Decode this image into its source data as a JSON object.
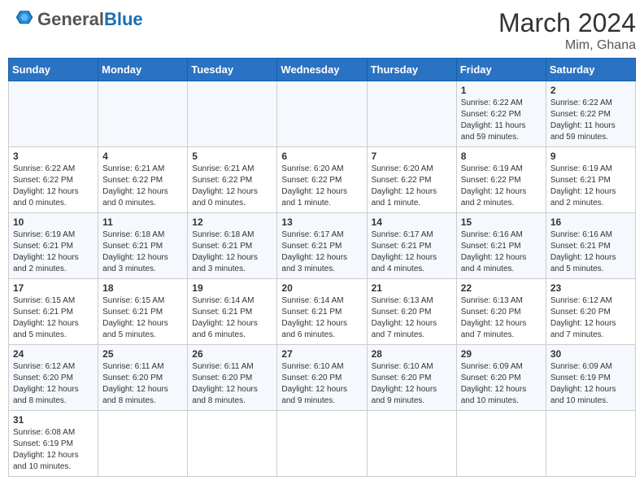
{
  "header": {
    "logo_general": "General",
    "logo_blue": "Blue",
    "title": "March 2024",
    "subtitle": "Mim, Ghana"
  },
  "weekdays": [
    "Sunday",
    "Monday",
    "Tuesday",
    "Wednesday",
    "Thursday",
    "Friday",
    "Saturday"
  ],
  "weeks": [
    [
      {
        "day": "",
        "info": ""
      },
      {
        "day": "",
        "info": ""
      },
      {
        "day": "",
        "info": ""
      },
      {
        "day": "",
        "info": ""
      },
      {
        "day": "",
        "info": ""
      },
      {
        "day": "1",
        "info": "Sunrise: 6:22 AM\nSunset: 6:22 PM\nDaylight: 11 hours and 59 minutes."
      },
      {
        "day": "2",
        "info": "Sunrise: 6:22 AM\nSunset: 6:22 PM\nDaylight: 11 hours and 59 minutes."
      }
    ],
    [
      {
        "day": "3",
        "info": "Sunrise: 6:22 AM\nSunset: 6:22 PM\nDaylight: 12 hours and 0 minutes."
      },
      {
        "day": "4",
        "info": "Sunrise: 6:21 AM\nSunset: 6:22 PM\nDaylight: 12 hours and 0 minutes."
      },
      {
        "day": "5",
        "info": "Sunrise: 6:21 AM\nSunset: 6:22 PM\nDaylight: 12 hours and 0 minutes."
      },
      {
        "day": "6",
        "info": "Sunrise: 6:20 AM\nSunset: 6:22 PM\nDaylight: 12 hours and 1 minute."
      },
      {
        "day": "7",
        "info": "Sunrise: 6:20 AM\nSunset: 6:22 PM\nDaylight: 12 hours and 1 minute."
      },
      {
        "day": "8",
        "info": "Sunrise: 6:19 AM\nSunset: 6:22 PM\nDaylight: 12 hours and 2 minutes."
      },
      {
        "day": "9",
        "info": "Sunrise: 6:19 AM\nSunset: 6:21 PM\nDaylight: 12 hours and 2 minutes."
      }
    ],
    [
      {
        "day": "10",
        "info": "Sunrise: 6:19 AM\nSunset: 6:21 PM\nDaylight: 12 hours and 2 minutes."
      },
      {
        "day": "11",
        "info": "Sunrise: 6:18 AM\nSunset: 6:21 PM\nDaylight: 12 hours and 3 minutes."
      },
      {
        "day": "12",
        "info": "Sunrise: 6:18 AM\nSunset: 6:21 PM\nDaylight: 12 hours and 3 minutes."
      },
      {
        "day": "13",
        "info": "Sunrise: 6:17 AM\nSunset: 6:21 PM\nDaylight: 12 hours and 3 minutes."
      },
      {
        "day": "14",
        "info": "Sunrise: 6:17 AM\nSunset: 6:21 PM\nDaylight: 12 hours and 4 minutes."
      },
      {
        "day": "15",
        "info": "Sunrise: 6:16 AM\nSunset: 6:21 PM\nDaylight: 12 hours and 4 minutes."
      },
      {
        "day": "16",
        "info": "Sunrise: 6:16 AM\nSunset: 6:21 PM\nDaylight: 12 hours and 5 minutes."
      }
    ],
    [
      {
        "day": "17",
        "info": "Sunrise: 6:15 AM\nSunset: 6:21 PM\nDaylight: 12 hours and 5 minutes."
      },
      {
        "day": "18",
        "info": "Sunrise: 6:15 AM\nSunset: 6:21 PM\nDaylight: 12 hours and 5 minutes."
      },
      {
        "day": "19",
        "info": "Sunrise: 6:14 AM\nSunset: 6:21 PM\nDaylight: 12 hours and 6 minutes."
      },
      {
        "day": "20",
        "info": "Sunrise: 6:14 AM\nSunset: 6:21 PM\nDaylight: 12 hours and 6 minutes."
      },
      {
        "day": "21",
        "info": "Sunrise: 6:13 AM\nSunset: 6:20 PM\nDaylight: 12 hours and 7 minutes."
      },
      {
        "day": "22",
        "info": "Sunrise: 6:13 AM\nSunset: 6:20 PM\nDaylight: 12 hours and 7 minutes."
      },
      {
        "day": "23",
        "info": "Sunrise: 6:12 AM\nSunset: 6:20 PM\nDaylight: 12 hours and 7 minutes."
      }
    ],
    [
      {
        "day": "24",
        "info": "Sunrise: 6:12 AM\nSunset: 6:20 PM\nDaylight: 12 hours and 8 minutes."
      },
      {
        "day": "25",
        "info": "Sunrise: 6:11 AM\nSunset: 6:20 PM\nDaylight: 12 hours and 8 minutes."
      },
      {
        "day": "26",
        "info": "Sunrise: 6:11 AM\nSunset: 6:20 PM\nDaylight: 12 hours and 8 minutes."
      },
      {
        "day": "27",
        "info": "Sunrise: 6:10 AM\nSunset: 6:20 PM\nDaylight: 12 hours and 9 minutes."
      },
      {
        "day": "28",
        "info": "Sunrise: 6:10 AM\nSunset: 6:20 PM\nDaylight: 12 hours and 9 minutes."
      },
      {
        "day": "29",
        "info": "Sunrise: 6:09 AM\nSunset: 6:20 PM\nDaylight: 12 hours and 10 minutes."
      },
      {
        "day": "30",
        "info": "Sunrise: 6:09 AM\nSunset: 6:19 PM\nDaylight: 12 hours and 10 minutes."
      }
    ],
    [
      {
        "day": "31",
        "info": "Sunrise: 6:08 AM\nSunset: 6:19 PM\nDaylight: 12 hours and 10 minutes."
      },
      {
        "day": "",
        "info": ""
      },
      {
        "day": "",
        "info": ""
      },
      {
        "day": "",
        "info": ""
      },
      {
        "day": "",
        "info": ""
      },
      {
        "day": "",
        "info": ""
      },
      {
        "day": "",
        "info": ""
      }
    ]
  ]
}
